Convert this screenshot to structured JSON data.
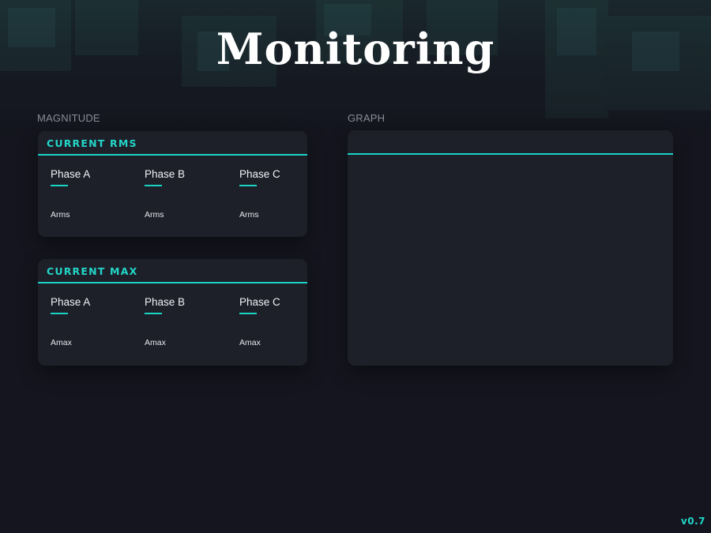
{
  "header": {
    "title": "Monitoring"
  },
  "sections": {
    "magnitude": "MAGNITUDE",
    "graph": "GRAPH"
  },
  "current_rms": {
    "title": "CURRENT RMS",
    "phases": [
      {
        "name": "Phase A",
        "value": "",
        "unit": "Arms"
      },
      {
        "name": "Phase B",
        "value": "",
        "unit": "Arms"
      },
      {
        "name": "Phase C",
        "value": "",
        "unit": "Arms"
      }
    ]
  },
  "current_max": {
    "title": "CURRENT MAX",
    "phases": [
      {
        "name": "Phase A",
        "value": "",
        "unit": "Amax"
      },
      {
        "name": "Phase B",
        "value": "",
        "unit": "Amax"
      },
      {
        "name": "Phase C",
        "value": "",
        "unit": "Amax"
      }
    ]
  },
  "graph": {
    "title": ""
  },
  "footer": {
    "version": "v0.7"
  },
  "colors": {
    "background": "#14151e",
    "card": "#1d1f29",
    "accent": "#19d3c5",
    "text": "#f2f3f6",
    "muted": "#8a8c96"
  },
  "icons": {
    "backdrop": "city-skyline-image"
  }
}
